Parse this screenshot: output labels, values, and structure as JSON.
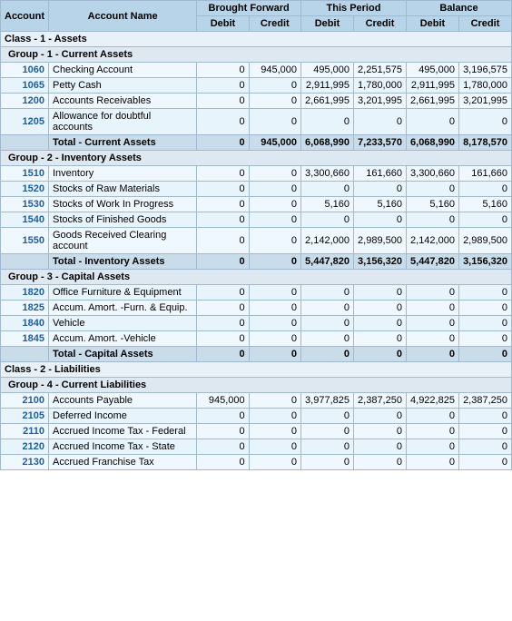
{
  "header": {
    "col1": "Account",
    "col2": "Account Name",
    "brought_forward": "Brought Forward",
    "this_period": "This Period",
    "balance": "Balance",
    "debit": "Debit",
    "credit": "Credit"
  },
  "sections": [
    {
      "type": "class",
      "label": "Class - 1 - Assets"
    },
    {
      "type": "group",
      "label": "Group - 1 - Current Assets"
    },
    {
      "type": "data",
      "account": "1060",
      "name": "Checking Account",
      "bf_debit": "0",
      "bf_credit": "945,000",
      "tp_debit": "495,000",
      "tp_credit": "2,251,575",
      "bal_debit": "495,000",
      "bal_credit": "3,196,575"
    },
    {
      "type": "data",
      "account": "1065",
      "name": "Petty Cash",
      "bf_debit": "0",
      "bf_credit": "0",
      "tp_debit": "2,911,995",
      "tp_credit": "1,780,000",
      "bal_debit": "2,911,995",
      "bal_credit": "1,780,000"
    },
    {
      "type": "data",
      "account": "1200",
      "name": "Accounts Receivables",
      "bf_debit": "0",
      "bf_credit": "0",
      "tp_debit": "2,661,995",
      "tp_credit": "3,201,995",
      "bal_debit": "2,661,995",
      "bal_credit": "3,201,995"
    },
    {
      "type": "data",
      "account": "1205",
      "name": "Allowance for doubtful accounts",
      "bf_debit": "0",
      "bf_credit": "0",
      "tp_debit": "0",
      "tp_credit": "0",
      "bal_debit": "0",
      "bal_credit": "0"
    },
    {
      "type": "total",
      "label": "Total - Current Assets",
      "bf_debit": "0",
      "bf_credit": "945,000",
      "tp_debit": "6,068,990",
      "tp_credit": "7,233,570",
      "bal_debit": "6,068,990",
      "bal_credit": "8,178,570"
    },
    {
      "type": "group",
      "label": "Group - 2 - Inventory Assets"
    },
    {
      "type": "data",
      "account": "1510",
      "name": "Inventory",
      "bf_debit": "0",
      "bf_credit": "0",
      "tp_debit": "3,300,660",
      "tp_credit": "161,660",
      "bal_debit": "3,300,660",
      "bal_credit": "161,660"
    },
    {
      "type": "data",
      "account": "1520",
      "name": "Stocks of Raw Materials",
      "bf_debit": "0",
      "bf_credit": "0",
      "tp_debit": "0",
      "tp_credit": "0",
      "bal_debit": "0",
      "bal_credit": "0"
    },
    {
      "type": "data",
      "account": "1530",
      "name": "Stocks of Work In Progress",
      "bf_debit": "0",
      "bf_credit": "0",
      "tp_debit": "5,160",
      "tp_credit": "5,160",
      "bal_debit": "5,160",
      "bal_credit": "5,160"
    },
    {
      "type": "data",
      "account": "1540",
      "name": "Stocks of Finished Goods",
      "bf_debit": "0",
      "bf_credit": "0",
      "tp_debit": "0",
      "tp_credit": "0",
      "bal_debit": "0",
      "bal_credit": "0"
    },
    {
      "type": "data",
      "account": "1550",
      "name": "Goods Received Clearing account",
      "bf_debit": "0",
      "bf_credit": "0",
      "tp_debit": "2,142,000",
      "tp_credit": "2,989,500",
      "bal_debit": "2,142,000",
      "bal_credit": "2,989,500"
    },
    {
      "type": "total",
      "label": "Total - Inventory Assets",
      "bf_debit": "0",
      "bf_credit": "0",
      "tp_debit": "5,447,820",
      "tp_credit": "3,156,320",
      "bal_debit": "5,447,820",
      "bal_credit": "3,156,320"
    },
    {
      "type": "group",
      "label": "Group - 3 - Capital Assets"
    },
    {
      "type": "data",
      "account": "1820",
      "name": "Office Furniture & Equipment",
      "bf_debit": "0",
      "bf_credit": "0",
      "tp_debit": "0",
      "tp_credit": "0",
      "bal_debit": "0",
      "bal_credit": "0"
    },
    {
      "type": "data",
      "account": "1825",
      "name": "Accum. Amort. -Furn. & Equip.",
      "bf_debit": "0",
      "bf_credit": "0",
      "tp_debit": "0",
      "tp_credit": "0",
      "bal_debit": "0",
      "bal_credit": "0"
    },
    {
      "type": "data",
      "account": "1840",
      "name": "Vehicle",
      "bf_debit": "0",
      "bf_credit": "0",
      "tp_debit": "0",
      "tp_credit": "0",
      "bal_debit": "0",
      "bal_credit": "0"
    },
    {
      "type": "data",
      "account": "1845",
      "name": "Accum. Amort. -Vehicle",
      "bf_debit": "0",
      "bf_credit": "0",
      "tp_debit": "0",
      "tp_credit": "0",
      "bal_debit": "0",
      "bal_credit": "0"
    },
    {
      "type": "total",
      "label": "Total - Capital Assets",
      "bf_debit": "0",
      "bf_credit": "0",
      "tp_debit": "0",
      "tp_credit": "0",
      "bal_debit": "0",
      "bal_credit": "0"
    },
    {
      "type": "class",
      "label": "Class - 2 - Liabilities"
    },
    {
      "type": "group",
      "label": "Group - 4 - Current Liabilities"
    },
    {
      "type": "data",
      "account": "2100",
      "name": "Accounts Payable",
      "bf_debit": "945,000",
      "bf_credit": "0",
      "tp_debit": "3,977,825",
      "tp_credit": "2,387,250",
      "bal_debit": "4,922,825",
      "bal_credit": "2,387,250"
    },
    {
      "type": "data",
      "account": "2105",
      "name": "Deferred Income",
      "bf_debit": "0",
      "bf_credit": "0",
      "tp_debit": "0",
      "tp_credit": "0",
      "bal_debit": "0",
      "bal_credit": "0"
    },
    {
      "type": "data",
      "account": "2110",
      "name": "Accrued Income Tax - Federal",
      "bf_debit": "0",
      "bf_credit": "0",
      "tp_debit": "0",
      "tp_credit": "0",
      "bal_debit": "0",
      "bal_credit": "0"
    },
    {
      "type": "data",
      "account": "2120",
      "name": "Accrued Income Tax - State",
      "bf_debit": "0",
      "bf_credit": "0",
      "tp_debit": "0",
      "tp_credit": "0",
      "bal_debit": "0",
      "bal_credit": "0"
    },
    {
      "type": "data",
      "account": "2130",
      "name": "Accrued Franchise Tax",
      "bf_debit": "0",
      "bf_credit": "0",
      "tp_debit": "0",
      "tp_credit": "0",
      "bal_debit": "0",
      "bal_credit": "0"
    }
  ]
}
